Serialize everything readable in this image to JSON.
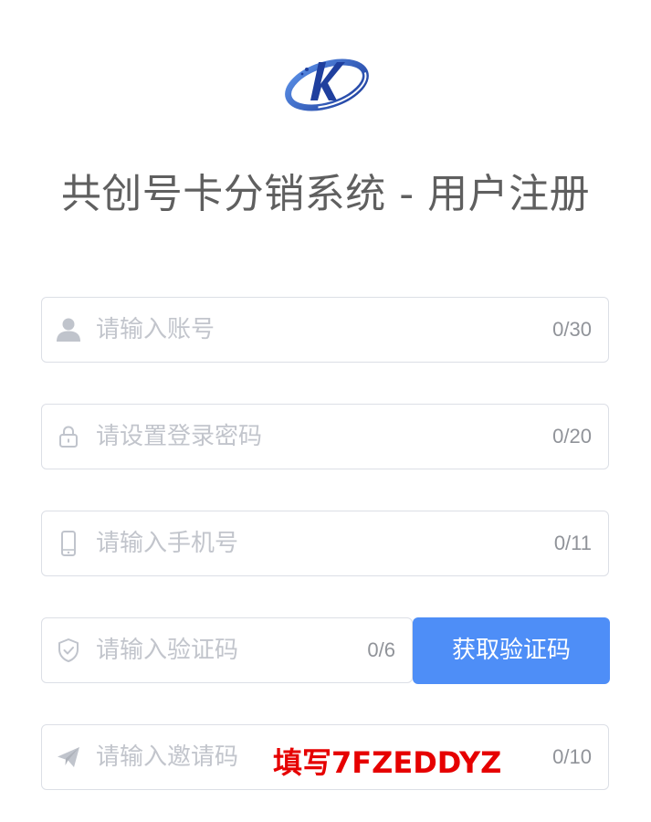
{
  "title": "共创号卡分销系统 - 用户注册",
  "logo_icon": "k-swoosh-logo",
  "accent_color": "#4e8ef7",
  "annotation_color": "#e60000",
  "fields": {
    "account": {
      "icon": "user-icon",
      "placeholder": "请输入账号",
      "value": "",
      "counter": "0/30"
    },
    "password": {
      "icon": "lock-icon",
      "placeholder": "请设置登录密码",
      "value": "",
      "counter": "0/20"
    },
    "phone": {
      "icon": "mobile-phone-icon",
      "placeholder": "请输入手机号",
      "value": "",
      "counter": "0/11"
    },
    "code": {
      "icon": "shield-check-icon",
      "placeholder": "请输入验证码",
      "value": "",
      "counter": "0/6"
    },
    "invite": {
      "icon": "paper-plane-icon",
      "placeholder": "请输入邀请码",
      "value": "",
      "counter": "0/10"
    }
  },
  "get_code_button": "获取验证码",
  "invite_note": "填写7FZEDDYZ"
}
